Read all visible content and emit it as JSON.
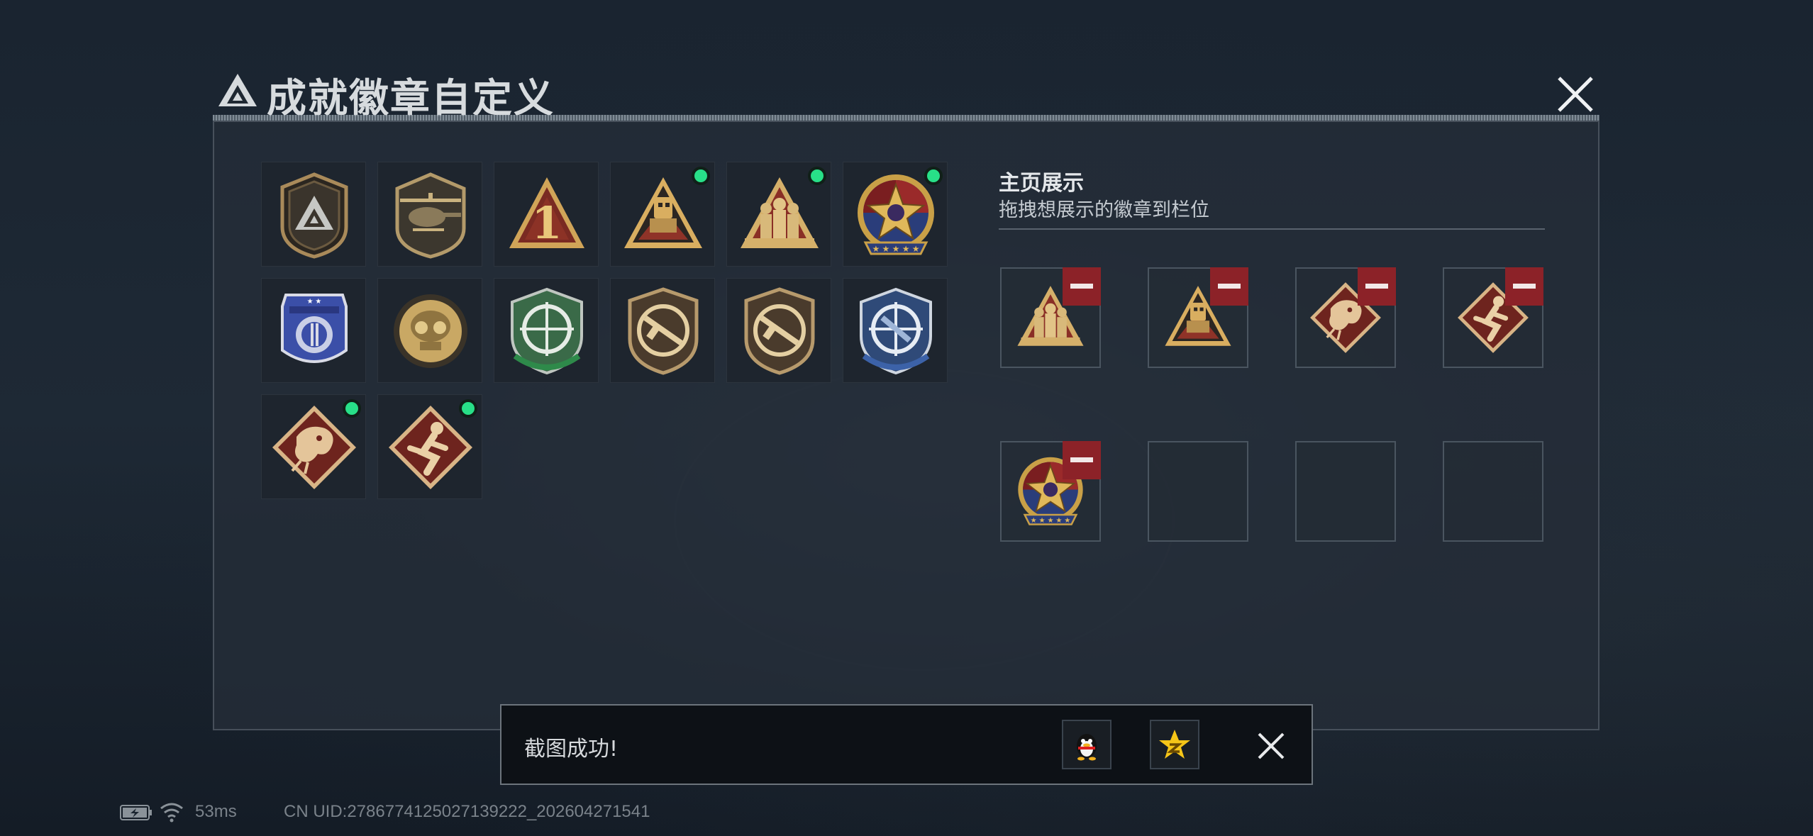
{
  "dialog": {
    "title": "成就徽章自定义",
    "logo_icon": "triangle-logo-icon",
    "close_icon": "close-icon"
  },
  "badges": [
    {
      "icon": "triangle-shield-badge-icon",
      "new": false
    },
    {
      "icon": "helicopter-shield-badge-icon",
      "new": false
    },
    {
      "icon": "rank-one-triangle-badge-icon",
      "new": false
    },
    {
      "icon": "robot-triangle-badge-icon",
      "new": true
    },
    {
      "icon": "soldiers-triangle-badge-icon",
      "new": true
    },
    {
      "icon": "star-emblem-badge-icon",
      "new": true
    },
    {
      "icon": "blue-wings-badge-icon",
      "new": false
    },
    {
      "icon": "gold-helmet-badge-icon",
      "new": false
    },
    {
      "icon": "green-crosshair-badge-icon",
      "new": false
    },
    {
      "icon": "rifle-shield-badge-icon",
      "new": false
    },
    {
      "icon": "rifle-shield-badge-icon",
      "new": false
    },
    {
      "icon": "blue-crosshair-badge-icon",
      "new": false
    },
    {
      "icon": "dragon-diamond-badge-icon",
      "new": true
    },
    {
      "icon": "runner-diamond-badge-icon",
      "new": true
    }
  ],
  "showcase": {
    "title": "主页展示",
    "subtitle": "拖拽想展示的徽章到栏位",
    "slots": [
      {
        "icon": "soldiers-triangle-badge-icon",
        "filled": true
      },
      {
        "icon": "robot-triangle-badge-icon",
        "filled": true
      },
      {
        "icon": "dragon-diamond-badge-icon",
        "filled": true
      },
      {
        "icon": "runner-diamond-badge-icon",
        "filled": true
      },
      {
        "icon": "star-emblem-badge-icon",
        "filled": true
      },
      {
        "icon": "",
        "filled": false
      },
      {
        "icon": "",
        "filled": false
      },
      {
        "icon": "",
        "filled": false
      }
    ]
  },
  "toast": {
    "message": "截图成功!",
    "share_qq_icon": "qq-penguin-icon",
    "share_qzone_icon": "qzone-star-icon",
    "close_icon": "close-icon"
  },
  "status": {
    "ping": "53ms",
    "uid": "CN UID:2786774125027139222_202604271541",
    "battery_icon": "battery-charging-icon",
    "wifi_icon": "wifi-icon"
  },
  "colors": {
    "new_dot": "#28e088",
    "remove_button": "#8c2228",
    "panel_bg": "#242d38",
    "badge_gold": "#c9a45c"
  }
}
